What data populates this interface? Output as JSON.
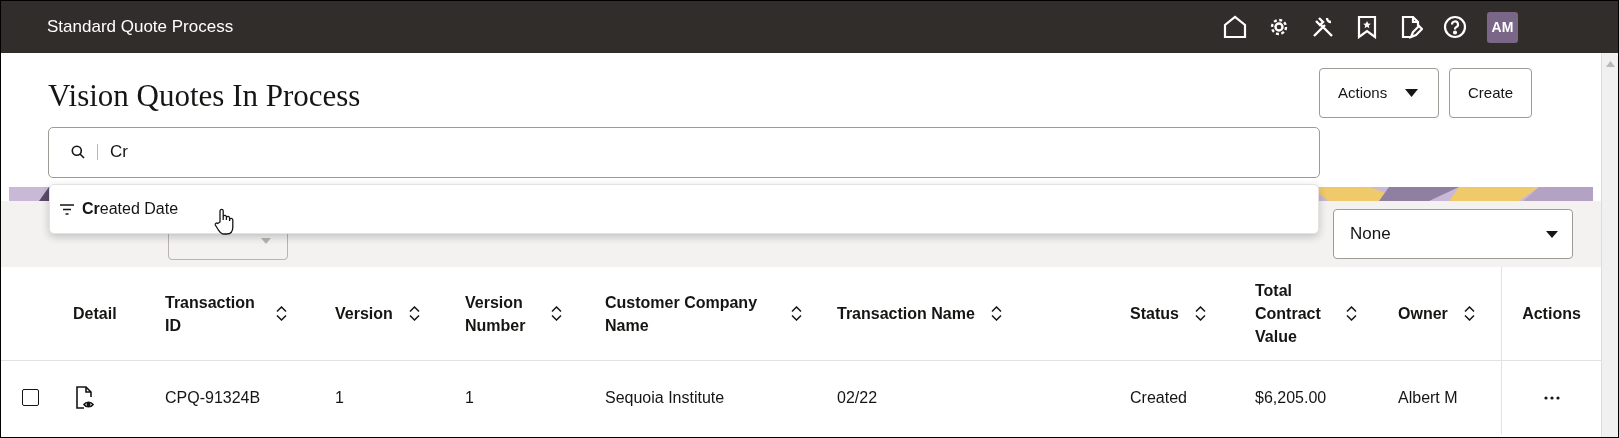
{
  "header": {
    "title": "Standard Quote Process",
    "avatar": "AM"
  },
  "page": {
    "title": "Vision Quotes In Process",
    "buttons": [
      {
        "label": "Actions",
        "kind": "menu"
      },
      {
        "label": "Create",
        "kind": "plain"
      }
    ]
  },
  "search": {
    "value": "Cr",
    "suggestions": [
      {
        "text": "**Cr**eated Date"
      }
    ]
  },
  "toolbar": {
    "actions_button": {
      "disabled": true
    },
    "group_by_value": "None"
  },
  "table": {
    "columns": [
      {
        "label": "Detail",
        "kind": "icon",
        "sortable": false
      },
      {
        "label": "Transaction ID",
        "kind": "text",
        "sortable": true
      },
      {
        "label": "Version",
        "kind": "text",
        "sortable": true
      },
      {
        "label": "Version Number",
        "kind": "text",
        "sortable": true
      },
      {
        "label": "Customer Company Name",
        "kind": "text",
        "sortable": true
      },
      {
        "label": "Transaction Name",
        "kind": "text",
        "sortable": true
      },
      {
        "label": "Status",
        "kind": "text",
        "sortable": true
      },
      {
        "label": "Total Contract Value",
        "kind": "text",
        "sortable": true
      },
      {
        "label": "Owner",
        "kind": "text",
        "sortable": true
      },
      {
        "label": "Actions",
        "kind": "menu",
        "sortable": false
      }
    ],
    "rows": [
      {
        "checked": false,
        "cells": [
          "",
          "CPQ-91324B",
          "1",
          "1",
          "Sequoia Institute",
          "02/22",
          "Created",
          "$6,205.00",
          "Albert M",
          ""
        ]
      }
    ]
  }
}
